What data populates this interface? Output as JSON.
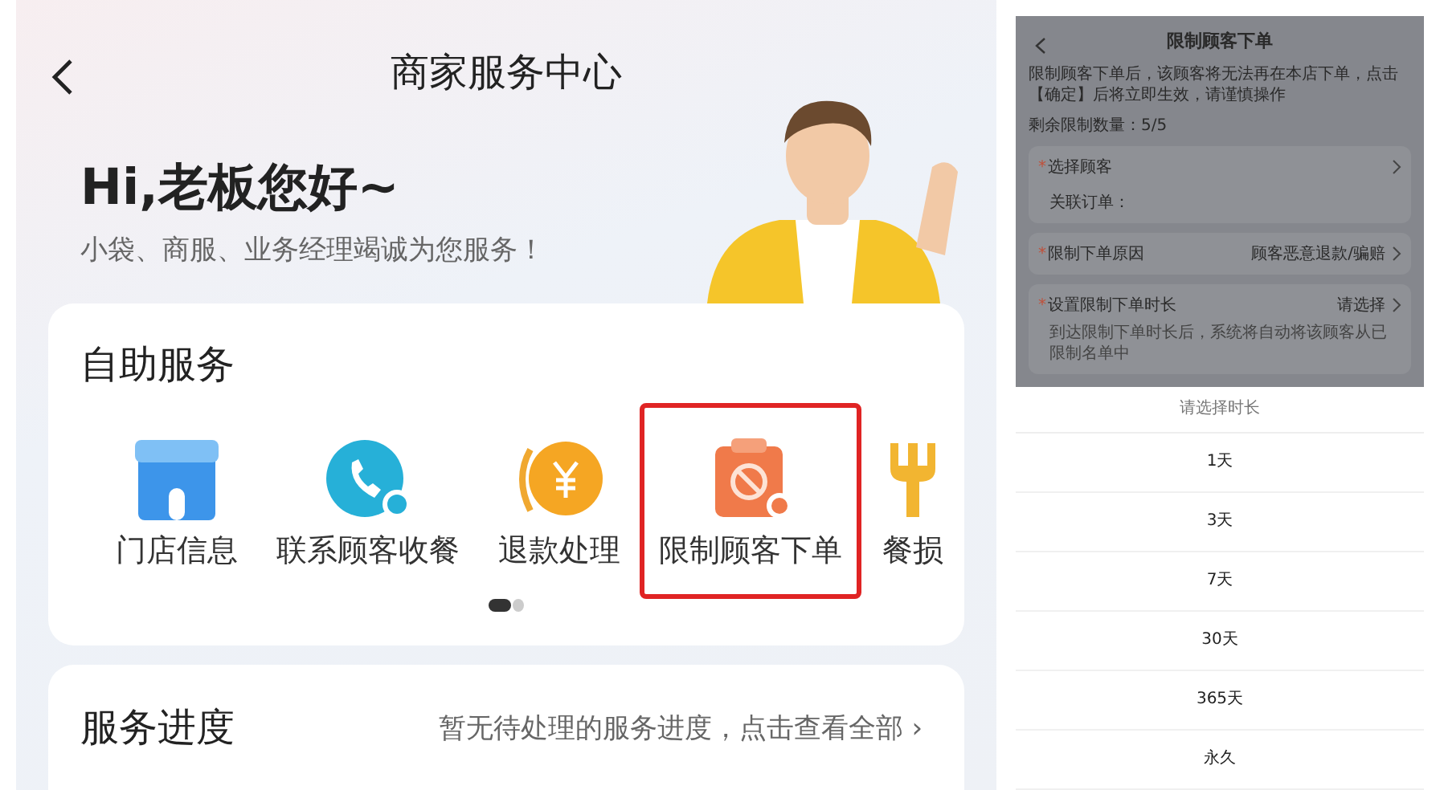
{
  "merchant_screen": {
    "title": "商家服务中心",
    "greeting": "Hi,老板您好~",
    "subtitle": "小袋、商服、业务经理竭诚为您服务！",
    "self_service": {
      "title": "自助服务",
      "items": [
        {
          "label": "门店信息",
          "kind": "store",
          "highlighted": false
        },
        {
          "label": "联系顾客收餐",
          "kind": "phone",
          "highlighted": false
        },
        {
          "label": "退款处理",
          "kind": "refund",
          "highlighted": false
        },
        {
          "label": "限制顾客下单",
          "kind": "block",
          "highlighted": true
        },
        {
          "label": "餐损",
          "kind": "fork",
          "highlighted": false
        }
      ]
    },
    "service_progress": {
      "title": "服务进度",
      "link": "暂无待处理的服务进度，点击查看全部 ›"
    }
  },
  "restrict_screen": {
    "title": "限制顾客下单",
    "description": "限制顾客下单后，该顾客将无法再在本店下单，点击【确定】后将立即生效，请谨慎操作",
    "remaining": "剩余限制数量：5/5",
    "fields": [
      {
        "required_mark": "*",
        "label": "选择顾客",
        "sub_label": "关联订单："
      },
      {
        "required_mark": "*",
        "label": "限制下单原因",
        "value": "顾客恶意退款/骗赔"
      },
      {
        "required_mark": "*",
        "label": "设置限制下单时长",
        "value": "请选择",
        "note": "到达限制下单时长后，系统将自动将该顾客从已限制名单中"
      }
    ],
    "picker": {
      "title": "请选择时长",
      "options": [
        "1天",
        "3天",
        "7天",
        "30天",
        "365天",
        "永久"
      ]
    }
  }
}
